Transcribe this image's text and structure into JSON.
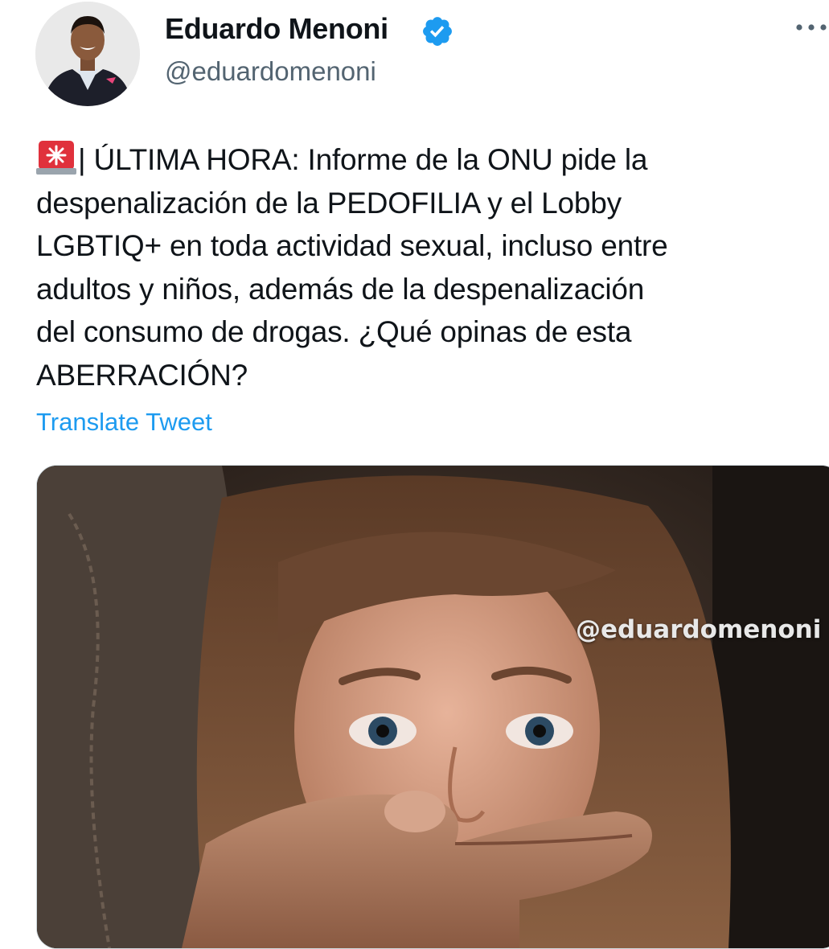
{
  "author": {
    "display_name": "Eduardo Menoni",
    "handle": "@eduardomenoni",
    "verified": true
  },
  "tweet": {
    "text_lines": [
      "| ÚLTIMA HORA: Informe de la ONU pide la",
      "despenalización de la PEDOFILIA y el Lobby",
      "LGBTIQ+ en toda actividad sexual, incluso entre",
      "adultos y niños, además de la despenalización",
      "del consumo de drogas. ¿Qué opinas de esta",
      "ABERRACIÓN?"
    ],
    "translate_label": "Translate Tweet"
  },
  "media": {
    "watermark": "@eduardomenoni"
  },
  "icons": {
    "verified": "verified-badge-icon",
    "more": "more-options-icon",
    "siren": "police-siren-icon"
  },
  "colors": {
    "accent": "#1d9bf0",
    "secondary_text": "#536471",
    "primary_text": "#0f1419",
    "siren_red": "#e0313c"
  }
}
